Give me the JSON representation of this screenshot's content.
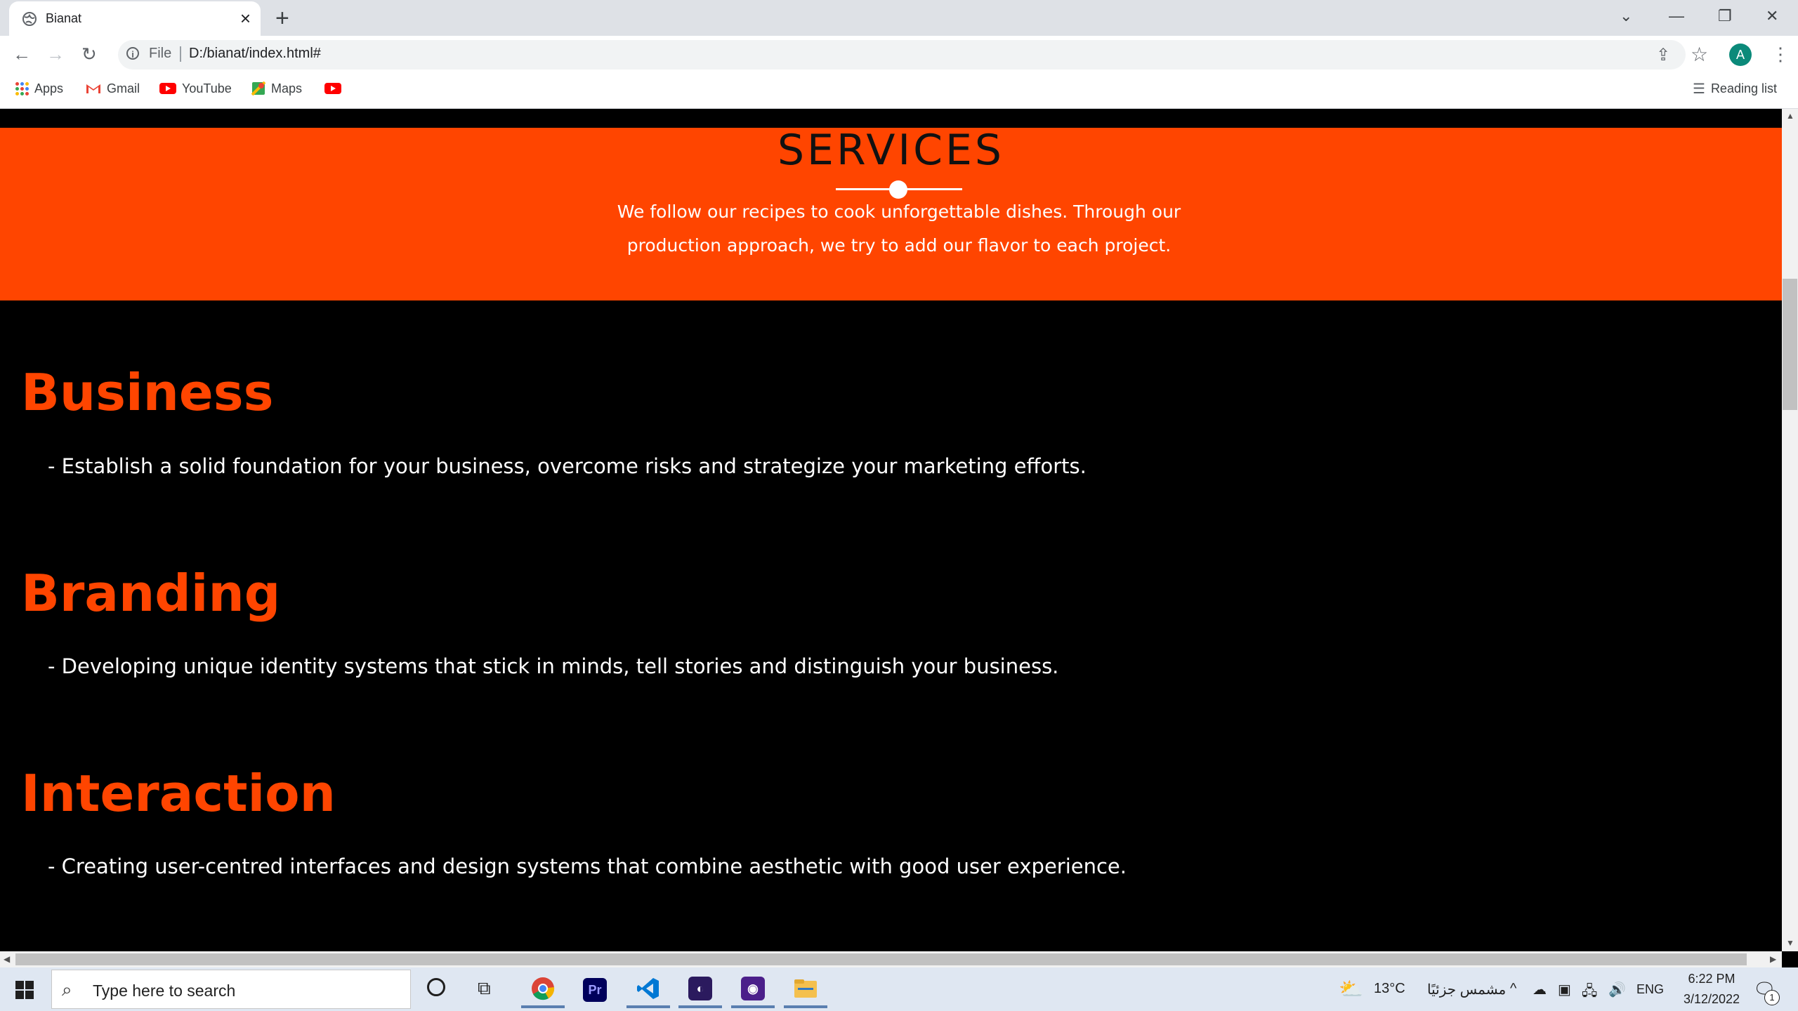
{
  "browser": {
    "tab_title": "Bianat",
    "url_scheme": "File",
    "url": "D:/bianat/index.html#",
    "avatar_letter": "A",
    "bookmarks": [
      {
        "label": "Apps",
        "icon": "apps-grid-icon"
      },
      {
        "label": "Gmail",
        "icon": "gmail-icon"
      },
      {
        "label": "YouTube",
        "icon": "youtube-icon"
      },
      {
        "label": "Maps",
        "icon": "maps-icon"
      },
      {
        "label": "",
        "icon": "youtube-icon"
      }
    ],
    "reading_list": "Reading list"
  },
  "page": {
    "services_title": "SERVICES",
    "services_description_line1": "We follow our recipes to cook unforgettable dishes. Through our",
    "services_description_line2": "production approach, we try to add our flavor to each project.",
    "services": [
      {
        "title": "Business",
        "description": "- Establish a solid foundation for your business, overcome risks and strategize your marketing efforts."
      },
      {
        "title": "Branding",
        "description": "- Developing unique identity systems that stick in minds, tell stories and distinguish your business."
      },
      {
        "title": "Interaction",
        "description": "- Creating user-centred interfaces and design systems that combine aesthetic with good user experience."
      }
    ],
    "colors": {
      "accent": "#ff4500",
      "background": "#000000",
      "text": "#ffffff"
    }
  },
  "taskbar": {
    "search_placeholder": "Type here to search",
    "apps": [
      "chrome-icon",
      "premiere-pro-icon",
      "vscode-icon",
      "app-icon",
      "app-icon",
      "file-explorer-icon"
    ],
    "weather": "13°C",
    "weather_desc": "مشمس جزئيًا",
    "language": "ENG",
    "time": "6:22 PM",
    "date": "3/12/2022",
    "notification_count": "1"
  }
}
